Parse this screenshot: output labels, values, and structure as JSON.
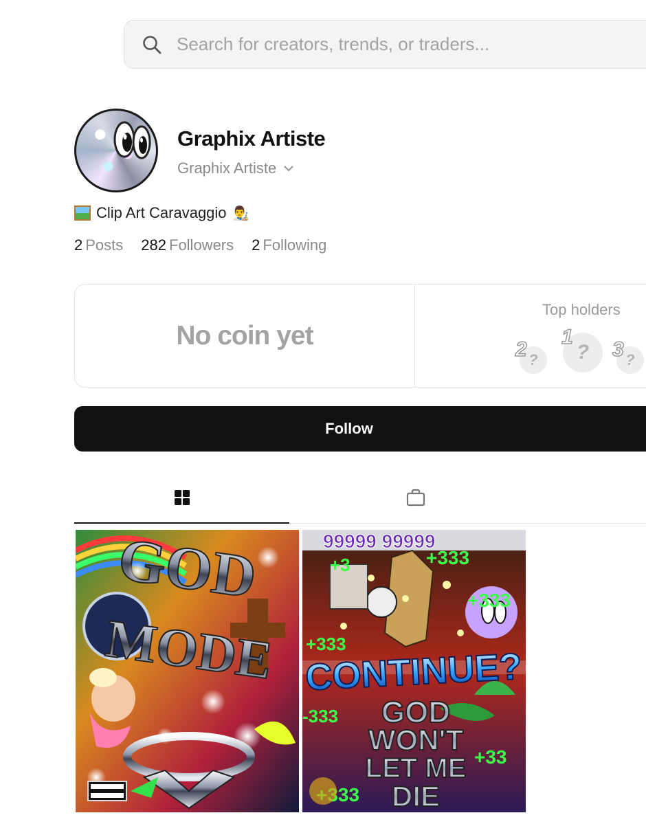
{
  "search": {
    "placeholder": "Search for creators, trends, or traders..."
  },
  "profile": {
    "display_name": "Graphix Artiste",
    "handle": "Graphix Artiste",
    "bio": "Clip Art Caravaggio",
    "stats": [
      {
        "count": "2",
        "label": "Posts"
      },
      {
        "count": "282",
        "label": "Followers"
      },
      {
        "count": "2",
        "label": "Following"
      }
    ]
  },
  "coin_card": {
    "status": "No coin yet",
    "top_holders_label": "Top holders",
    "holders": [
      {
        "rank": "2",
        "placeholder": "?"
      },
      {
        "rank": "1",
        "placeholder": "?"
      },
      {
        "rank": "3",
        "placeholder": "?"
      }
    ]
  },
  "follow_button": {
    "label": "Follow"
  },
  "tabs": [
    {
      "icon": "grid-icon",
      "active": true
    },
    {
      "icon": "bag-icon",
      "active": false
    },
    {
      "icon": "bolt-icon",
      "active": false
    }
  ],
  "posts": [
    {
      "title_words": [
        "GOD",
        "MODE"
      ],
      "badge": "PARENTAL ADVISORY"
    },
    {
      "title_words": [
        "CONTINUE?",
        "GOD",
        "WON'T",
        "LET ME",
        "DIE"
      ],
      "numbers": [
        "99999",
        "+333"
      ]
    }
  ],
  "colors": {
    "primary_button": "#111111",
    "muted_text": "#8a8a8a",
    "border": "#e3e3e3"
  }
}
